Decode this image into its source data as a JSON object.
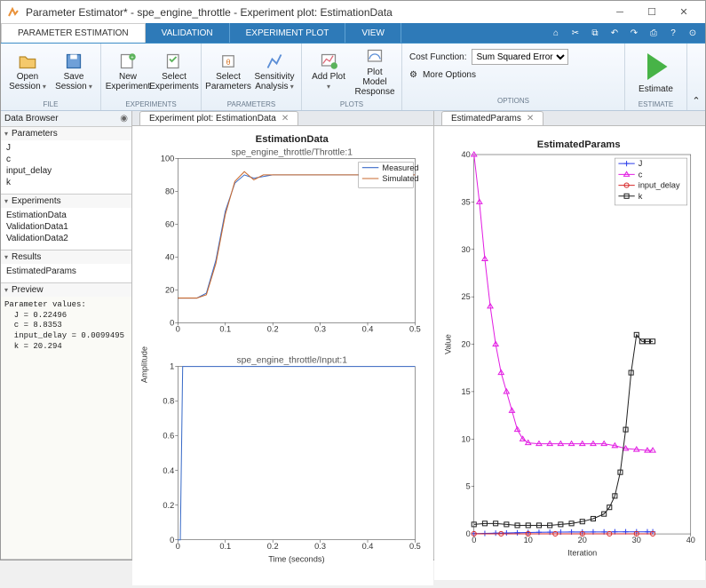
{
  "window": {
    "title": "Parameter Estimator* - spe_engine_throttle - Experiment plot: EstimationData"
  },
  "ribbon_tabs": [
    "PARAMETER ESTIMATION",
    "VALIDATION",
    "EXPERIMENT PLOT",
    "VIEW"
  ],
  "toolstrip": {
    "file": {
      "open": "Open Session",
      "save": "Save Session",
      "label": "FILE"
    },
    "experiments": {
      "new": "New Experiment",
      "select": "Select Experiments",
      "label": "EXPERIMENTS"
    },
    "parameters": {
      "select": "Select Parameters",
      "sens": "Sensitivity Analysis",
      "label": "PARAMETERS"
    },
    "plots": {
      "add": "Add Plot",
      "model": "Plot Model Response",
      "label": "PLOTS"
    },
    "options": {
      "cost_label": "Cost Function:",
      "cost_value": "Sum Squared Error",
      "more": "More Options",
      "label": "OPTIONS"
    },
    "estimate": {
      "btn": "Estimate",
      "label": "ESTIMATE"
    }
  },
  "browser": {
    "title": "Data Browser",
    "parameters_header": "Parameters",
    "parameters": [
      "J",
      "c",
      "input_delay",
      "k"
    ],
    "experiments_header": "Experiments",
    "experiments": [
      "EstimationData",
      "ValidationData1",
      "ValidationData2"
    ],
    "results_header": "Results",
    "results": [
      "EstimatedParams"
    ],
    "preview_header": "Preview",
    "preview": "Parameter values:\n  J = 0.22496\n  c = 8.8353\n  input_delay = 0.0099495\n  k = 20.294"
  },
  "left_plot": {
    "tab": "Experiment plot: EstimationData",
    "title": "EstimationData",
    "sub1": "spe_engine_throttle/Throttle:1",
    "sub2": "spe_engine_throttle/Input:1",
    "xlabel": "Time (seconds)",
    "ylabel": "Amplitude",
    "legend": [
      "Measured",
      "Simulated"
    ]
  },
  "right_plot": {
    "tab": "EstimatedParams",
    "title": "EstimatedParams",
    "xlabel": "Iteration",
    "ylabel": "Value",
    "legend": [
      "J",
      "c",
      "input_delay",
      "k"
    ]
  },
  "chart_data": [
    {
      "type": "line",
      "name": "Throttle:1",
      "xlim": [
        0,
        0.5
      ],
      "ylim": [
        0,
        100
      ],
      "xticks": [
        0,
        0.1,
        0.2,
        0.3,
        0.4,
        0.5
      ],
      "yticks": [
        0,
        20,
        40,
        60,
        80,
        100
      ],
      "series": [
        {
          "name": "Measured",
          "color": "#3b6cc8",
          "x": [
            0,
            0.02,
            0.04,
            0.06,
            0.08,
            0.1,
            0.12,
            0.14,
            0.16,
            0.18,
            0.2,
            0.25,
            0.3,
            0.4,
            0.5
          ],
          "y": [
            15,
            15,
            15,
            18,
            38,
            68,
            85,
            90,
            88,
            89,
            90,
            90,
            90,
            90,
            90
          ]
        },
        {
          "name": "Simulated",
          "color": "#c96a2f",
          "x": [
            0,
            0.02,
            0.04,
            0.06,
            0.08,
            0.1,
            0.12,
            0.14,
            0.16,
            0.18,
            0.2,
            0.25,
            0.3,
            0.4,
            0.5
          ],
          "y": [
            15,
            15,
            15,
            17,
            36,
            66,
            86,
            92,
            87,
            90,
            90,
            90,
            90,
            90,
            90
          ]
        }
      ]
    },
    {
      "type": "line",
      "name": "Input:1",
      "xlim": [
        0,
        0.5
      ],
      "ylim": [
        0,
        1
      ],
      "xticks": [
        0,
        0.1,
        0.2,
        0.3,
        0.4,
        0.5
      ],
      "yticks": [
        0,
        0.2,
        0.4,
        0.6,
        0.8,
        1
      ],
      "series": [
        {
          "name": "Input",
          "color": "#3b6cc8",
          "x": [
            0,
            0.005,
            0.01,
            0.5
          ],
          "y": [
            0,
            0,
            1,
            1
          ]
        }
      ]
    },
    {
      "type": "line",
      "name": "EstimatedParams",
      "xlim": [
        0,
        40
      ],
      "ylim": [
        0,
        40
      ],
      "xticks": [
        0,
        10,
        20,
        30,
        40
      ],
      "yticks": [
        0,
        5,
        10,
        15,
        20,
        25,
        30,
        35,
        40
      ],
      "series": [
        {
          "name": "J",
          "color": "#2c3eea",
          "marker": "plus",
          "x": [
            0,
            2,
            4,
            6,
            8,
            10,
            12,
            14,
            16,
            18,
            20,
            22,
            24,
            26,
            28,
            30,
            32,
            33
          ],
          "y": [
            0.03,
            0.05,
            0.08,
            0.1,
            0.12,
            0.15,
            0.17,
            0.18,
            0.19,
            0.2,
            0.2,
            0.21,
            0.21,
            0.22,
            0.22,
            0.22,
            0.22,
            0.22
          ]
        },
        {
          "name": "c",
          "color": "#e21ee2",
          "marker": "triangle",
          "x": [
            0,
            1,
            2,
            3,
            4,
            5,
            6,
            7,
            8,
            9,
            10,
            12,
            14,
            16,
            18,
            20,
            22,
            24,
            26,
            28,
            30,
            32,
            33
          ],
          "y": [
            40,
            35,
            29,
            24,
            20,
            17,
            15,
            13,
            11,
            10,
            9.6,
            9.5,
            9.5,
            9.5,
            9.5,
            9.5,
            9.5,
            9.5,
            9.3,
            9.0,
            8.9,
            8.8,
            8.8
          ]
        },
        {
          "name": "input_delay",
          "color": "#d62728",
          "marker": "circle",
          "x": [
            0,
            5,
            10,
            15,
            20,
            25,
            30,
            33
          ],
          "y": [
            0.01,
            0.01,
            0.01,
            0.01,
            0.01,
            0.01,
            0.01,
            0.01
          ]
        },
        {
          "name": "k",
          "color": "#222",
          "marker": "square",
          "x": [
            0,
            2,
            4,
            6,
            8,
            10,
            12,
            14,
            16,
            18,
            20,
            22,
            24,
            25,
            26,
            27,
            28,
            29,
            30,
            31,
            32,
            33
          ],
          "y": [
            1.0,
            1.1,
            1.1,
            1.0,
            0.9,
            0.9,
            0.9,
            0.9,
            1.0,
            1.1,
            1.3,
            1.6,
            2.1,
            2.8,
            4.0,
            6.5,
            11,
            17,
            21,
            20.3,
            20.3,
            20.3
          ]
        }
      ]
    }
  ]
}
